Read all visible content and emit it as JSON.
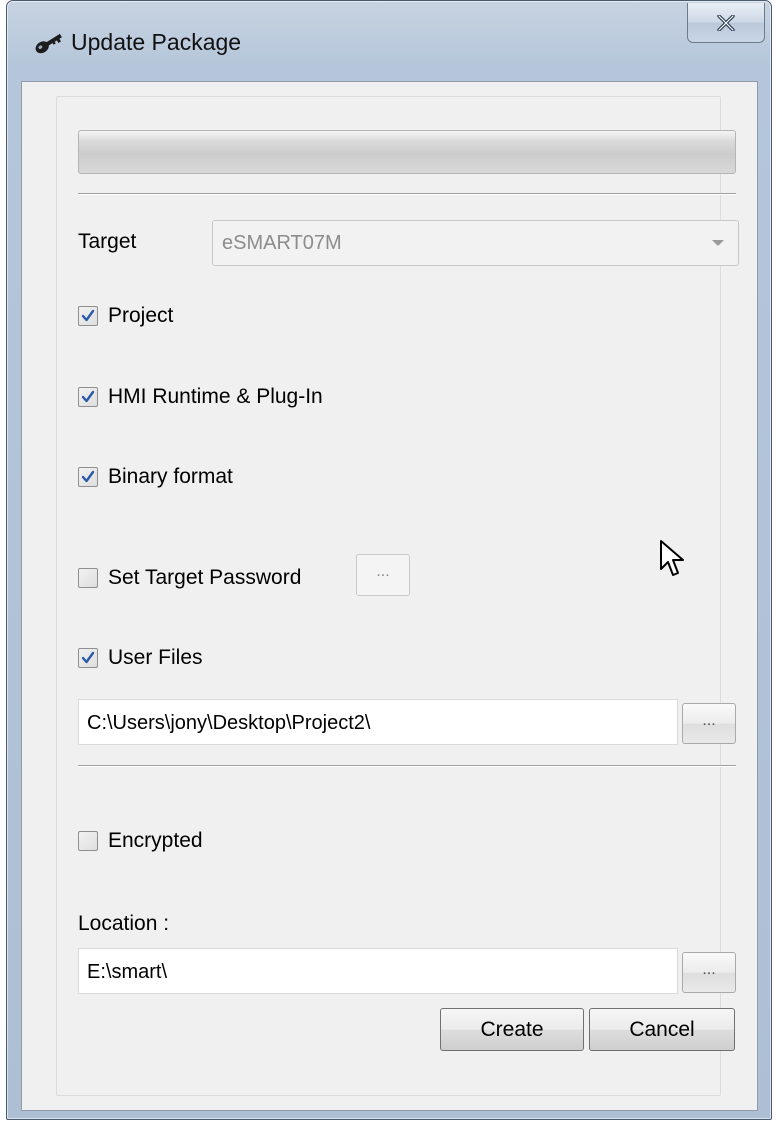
{
  "window": {
    "title": "Update Package",
    "title_icon": "key-icon",
    "close_label": "X"
  },
  "progress": {
    "value": 0
  },
  "target": {
    "label": "Target",
    "selected": "eSMART07M",
    "enabled": false
  },
  "checkboxes": {
    "project": {
      "label": "Project",
      "checked": true
    },
    "runtime": {
      "label": "HMI Runtime & Plug-In",
      "checked": true
    },
    "binary": {
      "label": "Binary format",
      "checked": true
    },
    "password": {
      "label": "Set Target Password",
      "checked": false,
      "button_label": "..."
    },
    "user_files": {
      "label": "User Files",
      "checked": true
    },
    "encrypted": {
      "label": "Encrypted",
      "checked": false
    }
  },
  "user_files_path": {
    "value": "C:\\Users\\jony\\Desktop\\Project2\\",
    "browse_label": "..."
  },
  "location": {
    "label": "Location :",
    "value": "E:\\smart\\",
    "browse_label": "..."
  },
  "actions": {
    "create_label": "Create",
    "cancel_label": "Cancel"
  },
  "colors": {
    "title_gradient": "#b5c6da",
    "client_bg": "#f0f0f0",
    "check_mark": "#2a5aa8"
  }
}
